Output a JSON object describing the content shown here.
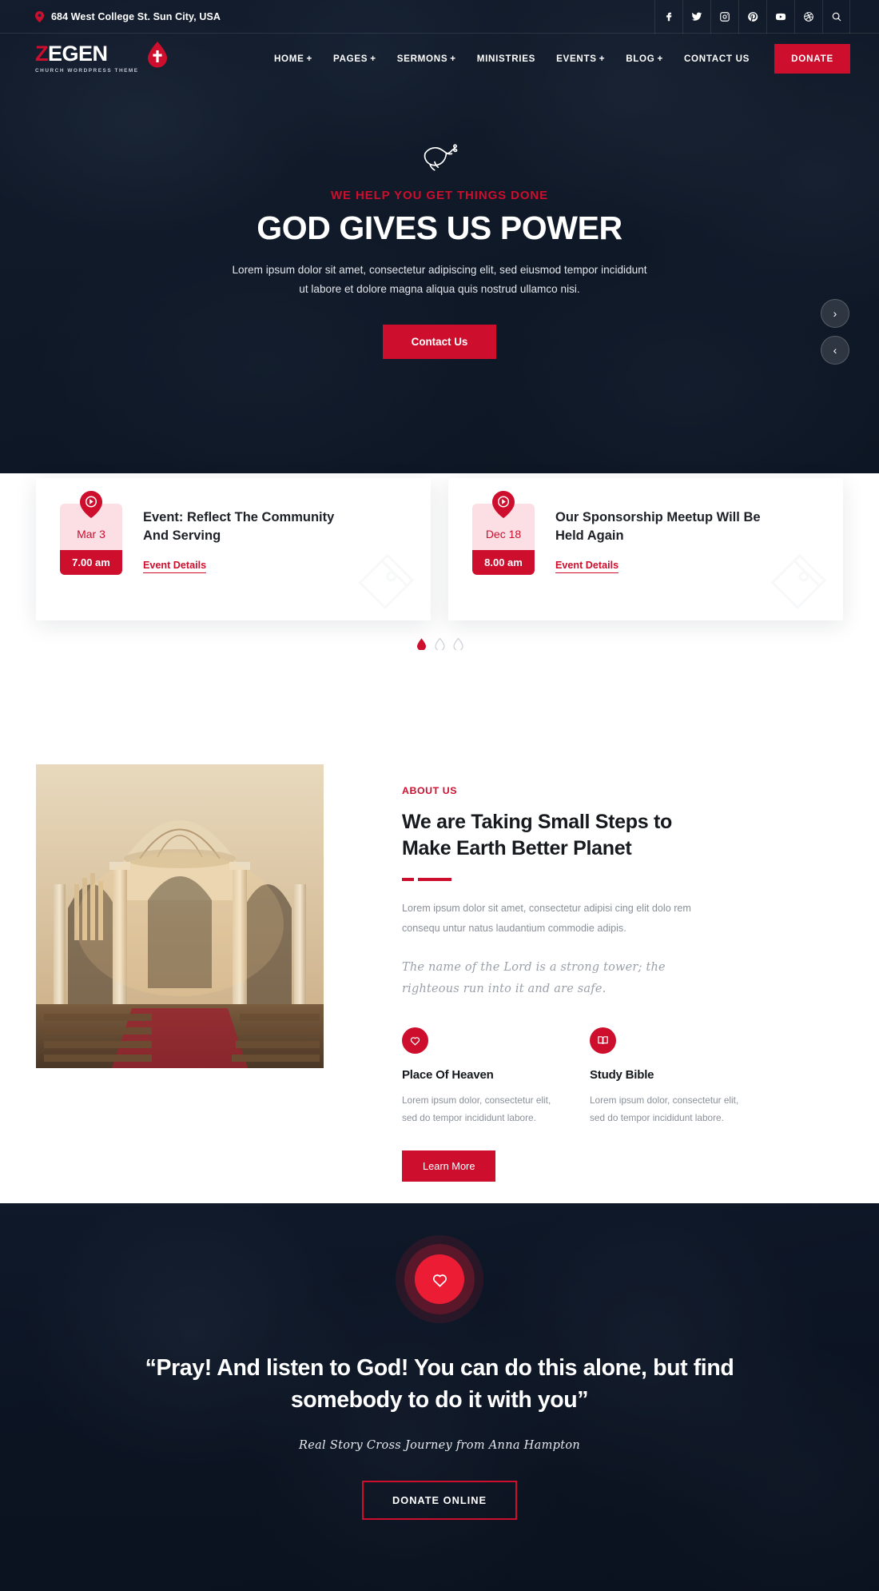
{
  "topbar": {
    "address": "684 West College St. Sun City, USA",
    "pin_icon": "map-pin-icon",
    "social": [
      {
        "name": "facebook-icon",
        "label": "Facebook"
      },
      {
        "name": "twitter-icon",
        "label": "Twitter"
      },
      {
        "name": "instagram-icon",
        "label": "Instagram"
      },
      {
        "name": "pinterest-icon",
        "label": "Pinterest"
      },
      {
        "name": "youtube-icon",
        "label": "YouTube"
      },
      {
        "name": "dribbble-icon",
        "label": "Dribbble"
      },
      {
        "name": "search-icon",
        "label": "Search"
      }
    ]
  },
  "logo": {
    "initial": "Z",
    "rest": "EGEN",
    "tagline": "CHURCH WORDPRESS THEME",
    "mark": "blood-drop-cross-icon"
  },
  "nav": {
    "items": [
      {
        "label": "HOME",
        "has_submenu": true
      },
      {
        "label": "PAGES",
        "has_submenu": true
      },
      {
        "label": "SERMONS",
        "has_submenu": true
      },
      {
        "label": "MINISTRIES",
        "has_submenu": false
      },
      {
        "label": "EVENTS",
        "has_submenu": true
      },
      {
        "label": "BLOG",
        "has_submenu": true
      },
      {
        "label": "CONTACT US",
        "has_submenu": false
      }
    ],
    "donate_label": "DONATE",
    "plus": "+"
  },
  "hero": {
    "dove_icon": "dove-icon",
    "kicker": "WE HELP YOU GET THINGS DONE",
    "title": "GOD GIVES US POWER",
    "description": "Lorem ipsum dolor sit amet, consectetur adipiscing elit, sed eiusmod tempor incididunt ut labore et dolore magna aliqua quis nostrud ullamco nisi.",
    "cta_label": "Contact Us",
    "next_arrow": "chevron-right-icon",
    "prev_arrow": "chevron-left-icon",
    "next_glyph": "›",
    "prev_glyph": "‹"
  },
  "events": [
    {
      "date": "Mar 3",
      "time": "7.00 am",
      "title": "Event: Reflect The Community And Serving",
      "link_label": "Event Details",
      "pin_icon": "event-pin-icon"
    },
    {
      "date": "Dec 18",
      "time": "8.00 am",
      "title": "Our Sponsorship Meetup Will Be Held Again",
      "link_label": "Event Details",
      "pin_icon": "event-pin-icon"
    }
  ],
  "slider_dots": {
    "count": 3,
    "active_index": 0,
    "shape": "water-drop-icon"
  },
  "about": {
    "kicker": "ABOUT US",
    "title": "We are Taking Small Steps to Make Earth Better Planet",
    "paragraph": "Lorem ipsum dolor sit amet, consectetur adipisi cing elit dolo rem consequ untur natus laudantium commodie adipis.",
    "quote": "The name of the Lord is a strong tower; the righteous run into it and are safe.",
    "features": [
      {
        "icon": "heart-icon",
        "title": "Place Of Heaven",
        "text": "Lorem ipsum dolor, consectetur elit, sed do tempor incididunt labore."
      },
      {
        "icon": "open-book-icon",
        "title": "Study Bible",
        "text": "Lorem ipsum dolor, consectetur elit, sed do tempor incididunt labore."
      }
    ],
    "button_label": "Learn More",
    "image_alt": "church-interior-photo"
  },
  "testimonial": {
    "badge_icon": "heart-icon",
    "quote": "“Pray! And listen to God! You can do this alone, but find somebody to do it with you”",
    "author": "Real Story Cross Journey from Anna Hampton",
    "button_label": "DONATE ONLINE"
  },
  "colors": {
    "accent": "#CE0E2D",
    "accent_bright": "#EC1C34",
    "dark": "#0f1a2c",
    "text_dark": "#16191d",
    "text_muted": "#8a8f99"
  }
}
